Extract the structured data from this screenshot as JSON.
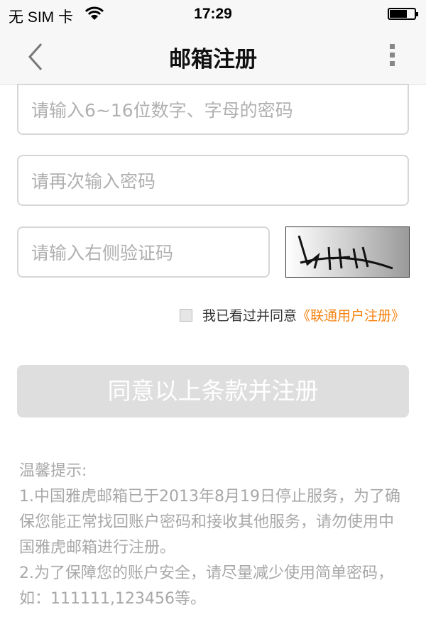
{
  "status_bar": {
    "carrier": "无 SIM 卡",
    "time": "17:29",
    "battery_level": 0.7,
    "icons": [
      "wifi-icon",
      "battery-icon"
    ]
  },
  "nav": {
    "title": "邮箱注册",
    "back_icon": "chevron-left-icon",
    "more_icon": "more-vertical-icon"
  },
  "form": {
    "password_placeholder": "请输入6~16位数字、字母的密码",
    "confirm_placeholder": "请再次输入密码",
    "captcha_placeholder": "请输入右侧验证码",
    "agree_text": "我已看过并同意",
    "agree_checked": false,
    "terms_link": "《联通用户注册》",
    "submit_label": "同意以上条款并注册"
  },
  "tips": {
    "title": "温馨提示:",
    "items": [
      "1.中国雅虎邮箱已于2013年8月19日停止服务，为了确保您能正常找回账户密码和接收其他服务，请勿使用中国雅虎邮箱进行注册。",
      "2.为了保障您的账户安全，请尽量减少使用简单密码，如：111111,123456等。"
    ]
  },
  "colors": {
    "accent": "#f5820f",
    "disabled_button": "#dedede"
  }
}
